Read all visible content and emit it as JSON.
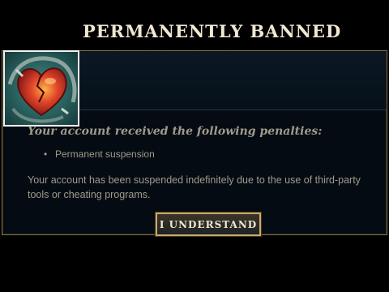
{
  "dialog": {
    "title": "PERMANENTLY BANNED",
    "subtitle": "Your account received the following penalties:",
    "penalties": [
      "Permanent suspension"
    ],
    "bullet": "•",
    "body": "Your account has been suspended indefinitely due to the use of third-party tools or cheating programs.",
    "confirm_label": "I UNDERSTAND"
  },
  "icons": {
    "emblem": "broken-heart-emblem-icon"
  },
  "colors": {
    "background": "#000000",
    "panel": "#050b12",
    "gold_border": "#c8aa6e",
    "title_text": "#f0e6d2",
    "body_text": "#a09b8c"
  }
}
